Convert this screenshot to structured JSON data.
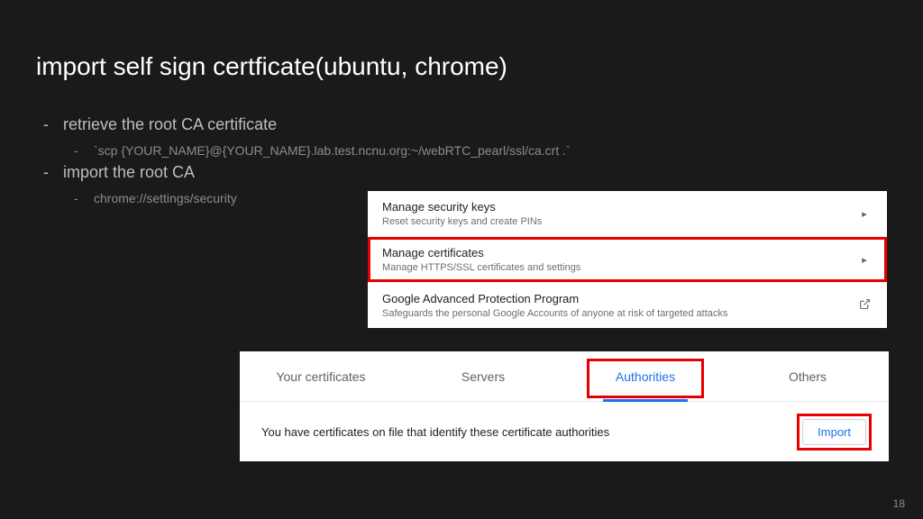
{
  "slide": {
    "title": "import self sign certficate(ubuntu, chrome)",
    "page_number": "18"
  },
  "bullets": {
    "b1": "retrieve the root CA certificate",
    "b1_sub": "`scp {YOUR_NAME}@{YOUR_NAME}.lab.test.ncnu.org:~/webRTC_pearl/ssl/ca.crt .`",
    "b2": "import the root CA",
    "b2_sub": "chrome://settings/security"
  },
  "shot1": {
    "rows": [
      {
        "title": "Manage security keys",
        "sub": "Reset security keys and create PINs",
        "icon": "chevron"
      },
      {
        "title": "Manage certificates",
        "sub": "Manage HTTPS/SSL certificates and settings",
        "icon": "chevron"
      },
      {
        "title": "Google Advanced Protection Program",
        "sub": "Safeguards the personal Google Accounts of anyone at risk of targeted attacks",
        "icon": "external"
      }
    ]
  },
  "shot2": {
    "tabs": [
      "Your certificates",
      "Servers",
      "Authorities",
      "Others"
    ],
    "active_tab": "Authorities",
    "description": "You have certificates on file that identify these certificate authorities",
    "import_label": "Import"
  }
}
